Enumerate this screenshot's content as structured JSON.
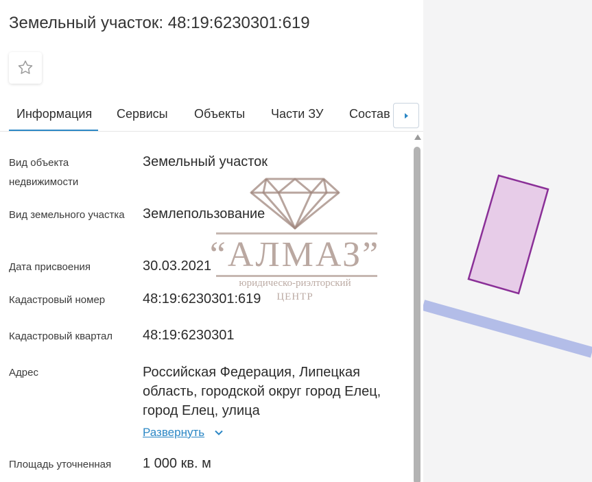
{
  "header": {
    "title": "Земельный участок: 48:19:6230301:619"
  },
  "favorite": {
    "icon": "star-outline-icon"
  },
  "tabs": [
    {
      "label": "Информация",
      "active": true
    },
    {
      "label": "Сервисы",
      "active": false
    },
    {
      "label": "Объекты",
      "active": false
    },
    {
      "label": "Части ЗУ",
      "active": false
    },
    {
      "label": "Состав",
      "active": false
    }
  ],
  "tab_next_icon": "caret-right-icon",
  "info": {
    "object_type": {
      "label": "Вид объекта недвижимости",
      "value": "Земельный участок"
    },
    "land_type": {
      "label": "Вид земельного участка",
      "value": "Землепользование"
    },
    "assign_date": {
      "label": "Дата присвоения",
      "value": "30.03.2021"
    },
    "cad_number": {
      "label": "Кадастровый номер",
      "value": "48:19:6230301:619"
    },
    "cad_quarter": {
      "label": "Кадастровый квартал",
      "value": "48:19:6230301"
    },
    "address": {
      "label": "Адрес",
      "value": "Российская Федерация, Липецкая область, городской округ город Елец, город Елец, улица",
      "expand_label": "Развернуть",
      "expand_icon": "chevron-down-icon"
    },
    "area": {
      "label": "Площадь уточненная",
      "value": "1 000 кв. м"
    }
  },
  "watermark": {
    "brand": "“АЛМАЗ”",
    "line1": "юридическо-риэлторский",
    "line2": "ЦЕНТР"
  },
  "colors": {
    "accent": "#2b87c5",
    "parcel_fill": "#e7cce8",
    "parcel_stroke": "#8a2f97",
    "road": "#b3bde8",
    "map_bg": "#f4f4f5"
  }
}
